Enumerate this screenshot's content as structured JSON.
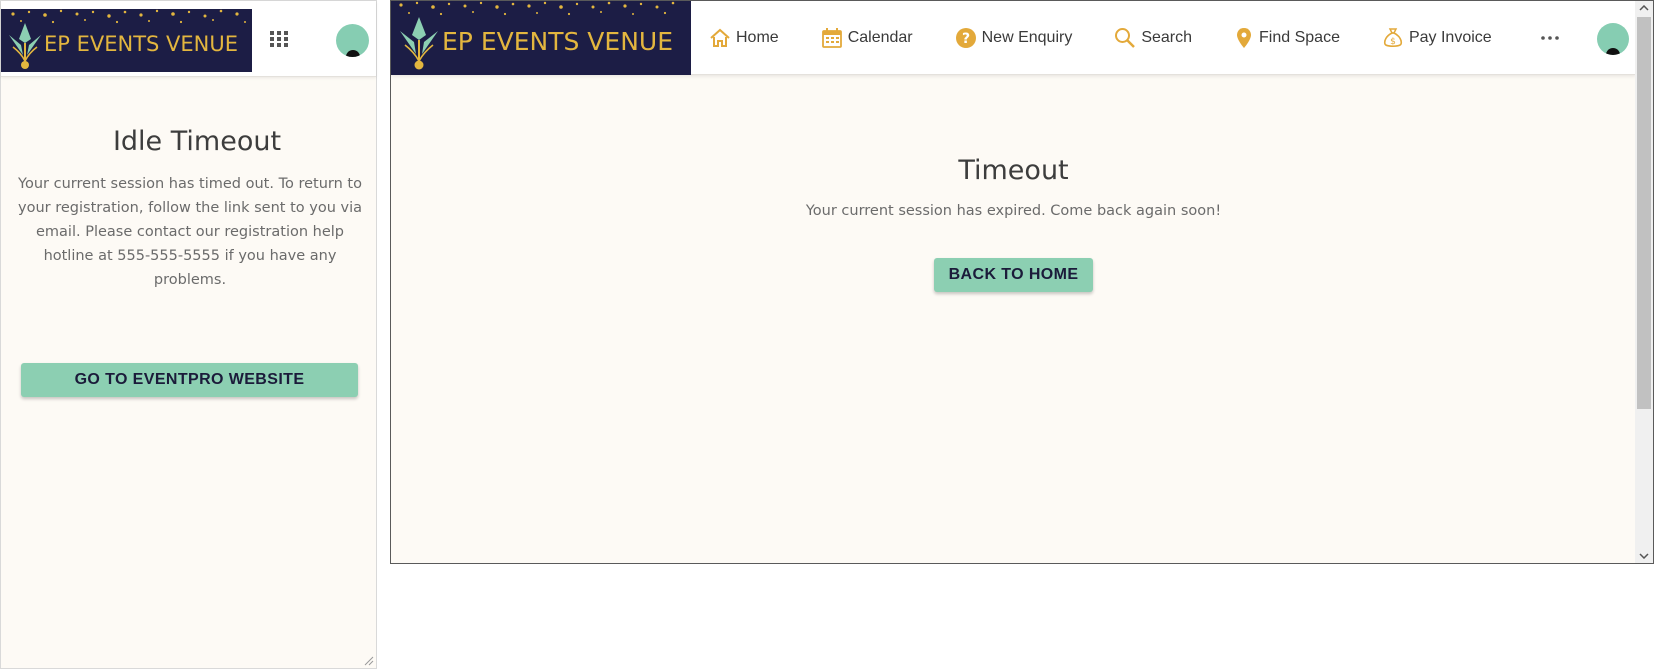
{
  "left_panel": {
    "logo_text": "EP EVENTS VENUE",
    "apps_icon": "apps-grid-icon",
    "avatar_icon": "user-avatar-icon",
    "title": "Idle Timeout",
    "message": "Your current session has timed out. To return to your registration, follow the link sent to you via email. Please contact our registration help hotline at 555-555-5555 if you have any problems.",
    "button_label": "GO TO EVENTPRO WEBSITE"
  },
  "right_window": {
    "logo_text": "EP EVENTS VENUE",
    "nav": [
      {
        "label": "Home",
        "icon": "home-icon"
      },
      {
        "label": "Calendar",
        "icon": "calendar-icon"
      },
      {
        "label": "New Enquiry",
        "icon": "question-icon"
      },
      {
        "label": "Search",
        "icon": "search-icon"
      },
      {
        "label": "Find Space",
        "icon": "map-pin-icon"
      },
      {
        "label": "Pay Invoice",
        "icon": "money-bag-icon"
      }
    ],
    "more_icon": "more-dots-icon",
    "avatar_icon": "user-avatar-icon",
    "title": "Timeout",
    "message": "Your current session has expired. Come back again soon!",
    "button_label": "BACK TO HOME"
  },
  "colors": {
    "brand_navy": "#1c1d45",
    "brand_gold": "#e3b63f",
    "accent_mint": "#8ccfb2",
    "page_background": "#fdfaf5"
  }
}
